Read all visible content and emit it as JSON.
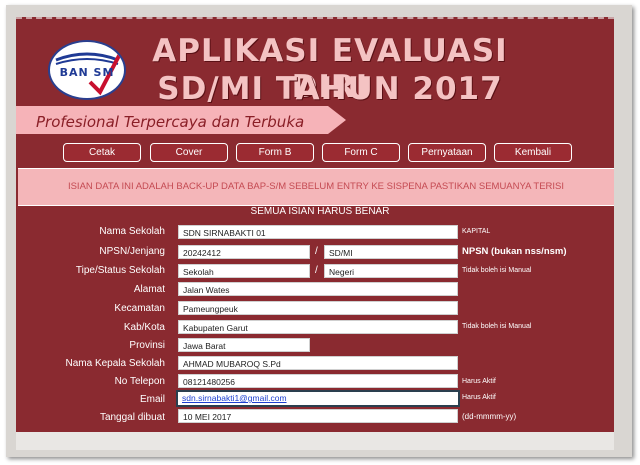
{
  "header": {
    "logo_text": "BAN SM",
    "title_line1": "APLIKASI EVALUASI DIRI",
    "title_line2": "SD/MI TAHUN 2017",
    "tagline": "Profesional Terpercaya dan Terbuka"
  },
  "colors": {
    "panel": "#8a2a30",
    "title": "#f4c3c3",
    "banner": "#f4b6b9",
    "ribbon": "#f6b3b8"
  },
  "nav": {
    "cetak": "Cetak",
    "cover": "Cover",
    "form_b": "Form B",
    "form_c": "Form C",
    "pernyataan": "Pernyataan",
    "kembali": "Kembali"
  },
  "banner": "ISIAN DATA INI ADALAH BACK-UP DATA BAP-S/M SEBELUM ENTRY KE SISPENA PASTIKAN SEMUANYA TERISI",
  "section_title": "SEMUA ISIAN HARUS BENAR",
  "form": {
    "nama_sekolah": {
      "label": "Nama Sekolah",
      "value": "SDN SIRNABAKTI 01",
      "note": "KAPITAL"
    },
    "npsn": {
      "label": "NPSN/Jenjang",
      "value": "20242412",
      "value2": "SD/MI",
      "note": "NPSN (bukan nss/nsm)"
    },
    "tipe": {
      "label": "Tipe/Status Sekolah",
      "value": "Sekolah",
      "value2": "Negeri",
      "note": "Tidak boleh isi Manual"
    },
    "alamat": {
      "label": "Alamat",
      "value": "Jalan Wates"
    },
    "kecamatan": {
      "label": "Kecamatan",
      "value": "Pameungpeuk"
    },
    "kabkota": {
      "label": "Kab/Kota",
      "value": "Kabupaten Garut",
      "note": "Tidak boleh isi Manual"
    },
    "provinsi": {
      "label": "Provinsi",
      "value": "Jawa Barat"
    },
    "kepala": {
      "label": "Nama Kepala Sekolah",
      "value": "AHMAD MUBAROQ S.Pd"
    },
    "telepon": {
      "label": "No Telepon",
      "value": "08121480256",
      "note": "Harus Aktif"
    },
    "email": {
      "label": "Email",
      "value": "sdn.sirnabakti1@gmail.com",
      "note": "Harus Aktif"
    },
    "tanggal": {
      "label": "Tanggal dibuat",
      "value": "10 MEI 2017",
      "note": "(dd-mmmm-yy)"
    }
  }
}
